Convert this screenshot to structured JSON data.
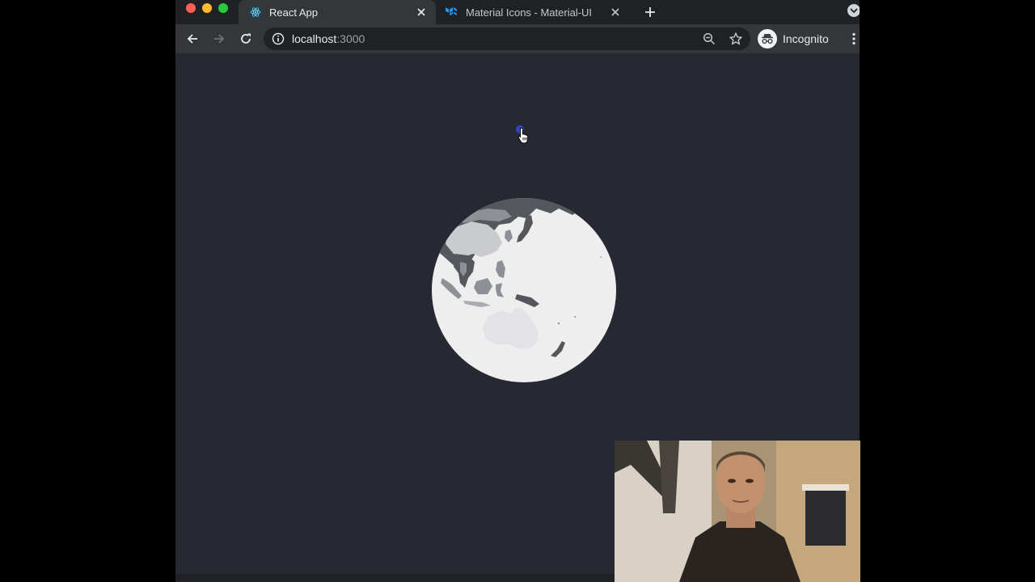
{
  "browser": {
    "tabs": [
      {
        "title": "React App",
        "active": true,
        "favicon": "react-logo-icon"
      },
      {
        "title": "Material Icons - Material-UI",
        "active": false,
        "favicon": "material-ui-logo-icon"
      }
    ],
    "address_bar": {
      "host": "localhost",
      "port": ":3000"
    },
    "profile": {
      "label": "Incognito",
      "icon": "incognito-icon"
    }
  },
  "colors": {
    "page_background": "#262832",
    "globe_ocean": "#eeeeee",
    "land_dark": "#54585d",
    "land_light": "#c9cbce",
    "cursor_marker": "#3b43c4"
  }
}
